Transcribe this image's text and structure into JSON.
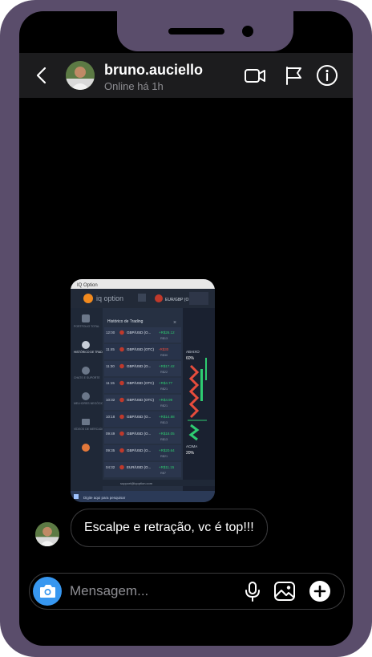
{
  "header": {
    "username": "bruno.auciello",
    "status": "Online há 1h"
  },
  "photo": {
    "app_name": "IQ Option",
    "brand": "iq option",
    "panel_title": "Histórico de Trading",
    "pair_tab": "EUR/GBP (O",
    "sidebar": [
      "PORTFOLIO TOTAL",
      "HISTÓRICO DE TRADING",
      "CHATS E SUPORTE",
      "MELHORES NEGÓCIOS",
      "VÍDEOS DE MERCADO"
    ],
    "trades": [
      {
        "time": "12:00",
        "pair": "GBP/USD (O...",
        "amount": "+R$26.12",
        "sub": "R$13"
      },
      {
        "time": "11:45",
        "pair": "GBP/USD (OTC)",
        "amount": "-R$30",
        "sub": "R$30"
      },
      {
        "time": "11:30",
        "pair": "GBP/USD (O...",
        "amount": "+R$17.42",
        "sub": "R$22"
      },
      {
        "time": "11:15",
        "pair": "GBP/USD (OTC)",
        "amount": "+R$4.77",
        "sub": "R$21"
      },
      {
        "time": "10:32",
        "pair": "GBP/USD (OTC)",
        "amount": "+R$4.99",
        "sub": "R$21"
      },
      {
        "time": "10:18",
        "pair": "GBP/USD (O...",
        "amount": "+R$14.88",
        "sub": "R$13"
      },
      {
        "time": "09:49",
        "pair": "GBP/USD (O...",
        "amount": "+R$18.05",
        "sub": "R$13"
      },
      {
        "time": "09:35",
        "pair": "GBP/USD (O...",
        "amount": "+R$20.64",
        "sub": "R$21"
      },
      {
        "time": "04:32",
        "pair": "EUR/USD (O...",
        "amount": "+R$11.15",
        "sub": "R$7"
      }
    ],
    "abaixo_label": "ABAIXO",
    "abaixo_pct": "60%",
    "acima_label": "ACIMA",
    "acima_pct": "20%",
    "support_email": "support@iqoption.com",
    "footer_search": "Digite aqui para pesquisar"
  },
  "message": {
    "text": "Escalpe e retração, vc é top!!!"
  },
  "composer": {
    "placeholder": "Mensagem..."
  },
  "colors": {
    "accent": "#3797f0",
    "frame": "#5a4d6b",
    "background": "#000000",
    "profit": "#2ecc71",
    "loss": "#e74c3c"
  },
  "icons": [
    "back-arrow-icon",
    "video-camera-icon",
    "flag-icon",
    "info-icon",
    "camera-icon",
    "microphone-icon",
    "gallery-icon",
    "plus-icon"
  ]
}
